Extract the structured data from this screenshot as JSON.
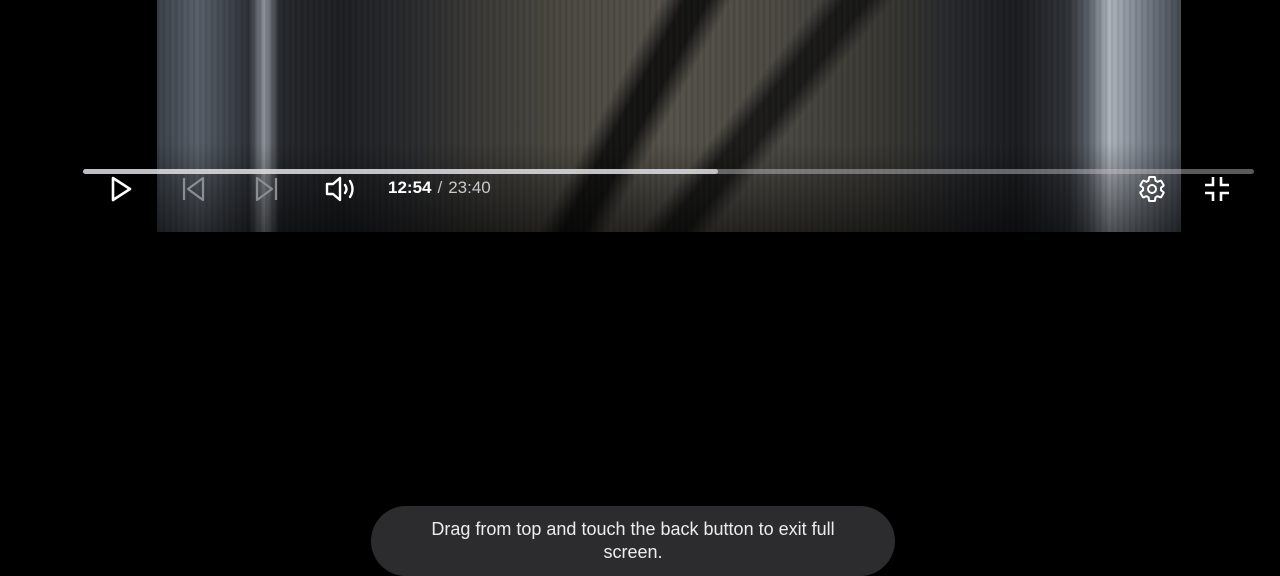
{
  "player": {
    "progress_fraction": 0.542,
    "current_time": "12:54",
    "separator": "/",
    "duration": "23:40"
  },
  "controls": {
    "play": {
      "icon": "play-icon"
    },
    "previous": {
      "icon": "skip-previous-icon"
    },
    "next": {
      "icon": "skip-next-icon"
    },
    "volume": {
      "icon": "volume-icon"
    },
    "settings": {
      "icon": "gear-icon"
    },
    "exit_fullscreen": {
      "icon": "exit-fullscreen-icon"
    }
  },
  "toast": {
    "message": "Drag from top and touch the back button to exit full screen."
  },
  "colors": {
    "background": "#000000",
    "toast_background": "#2c2c2e",
    "icon": "#ffffff",
    "icon_disabled": "#8a8d92"
  }
}
